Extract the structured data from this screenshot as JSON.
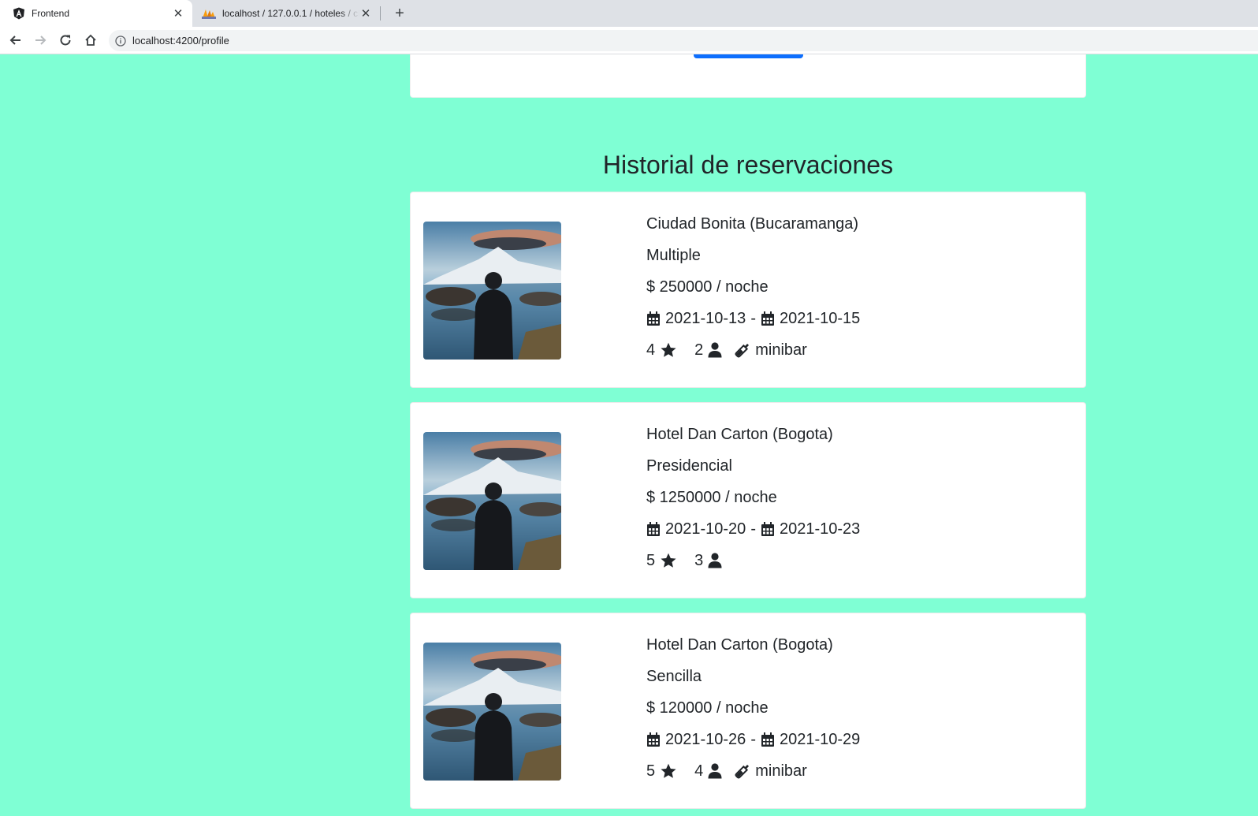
{
  "browser": {
    "tabs": [
      {
        "title": "Frontend",
        "active": true
      },
      {
        "title": "localhost / 127.0.0.1 / hoteles / cl",
        "active": false
      }
    ],
    "address": "localhost:4200/profile"
  },
  "history": {
    "title": "Historial de reservaciones",
    "reservations": [
      {
        "hotel": "Ciudad Bonita (Bucaramanga)",
        "room_type": "Multiple",
        "price": "$ 250000 / noche",
        "check_in": "2021-10-13",
        "check_out": "2021-10-15",
        "stars": "4",
        "guests": "2",
        "amenity": "minibar"
      },
      {
        "hotel": "Hotel Dan Carton (Bogota)",
        "room_type": "Presidencial",
        "price": "$ 1250000 / noche",
        "check_in": "2021-10-20",
        "check_out": "2021-10-23",
        "stars": "5",
        "guests": "3",
        "amenity": null
      },
      {
        "hotel": "Hotel Dan Carton (Bogota)",
        "room_type": "Sencilla",
        "price": "$ 120000 / noche",
        "check_in": "2021-10-26",
        "check_out": "2021-10-29",
        "stars": "5",
        "guests": "4",
        "amenity": "minibar"
      }
    ]
  }
}
